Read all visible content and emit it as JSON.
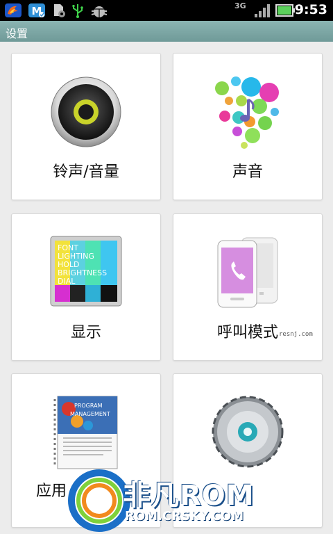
{
  "status_bar": {
    "time": "9:53",
    "network_label": "3G",
    "icons": [
      "app-flame-icon",
      "maxthon-icon",
      "sd-settings-icon",
      "usb-icon",
      "debug-android-icon",
      "signal-icon",
      "battery-icon"
    ]
  },
  "header": {
    "title": "设置"
  },
  "tiles": [
    {
      "label": "铃声/音量",
      "icon": "speaker-icon"
    },
    {
      "label": "声音",
      "icon": "sound-bubbles-icon"
    },
    {
      "label": "显示",
      "icon": "display-icon"
    },
    {
      "label": "呼叫模式",
      "icon": "phone-icon"
    },
    {
      "label": "应用",
      "icon": "program-management-icon"
    },
    {
      "label": "",
      "icon": "gear-disc-icon"
    }
  ],
  "display_icon_text": [
    "FONT",
    "LIGHTING",
    "HOLD",
    "BRIGHTNESS",
    "DIAL"
  ],
  "program_icon_text": [
    "PROGRAM",
    "MANAGEMENT"
  ],
  "small_credit": "resnj.com",
  "watermark": {
    "main": "非凡ROM",
    "sub": "ROM.CRSKY.COM"
  },
  "colors": {
    "title_bar": "#7fa8a8",
    "background": "#ececec"
  }
}
